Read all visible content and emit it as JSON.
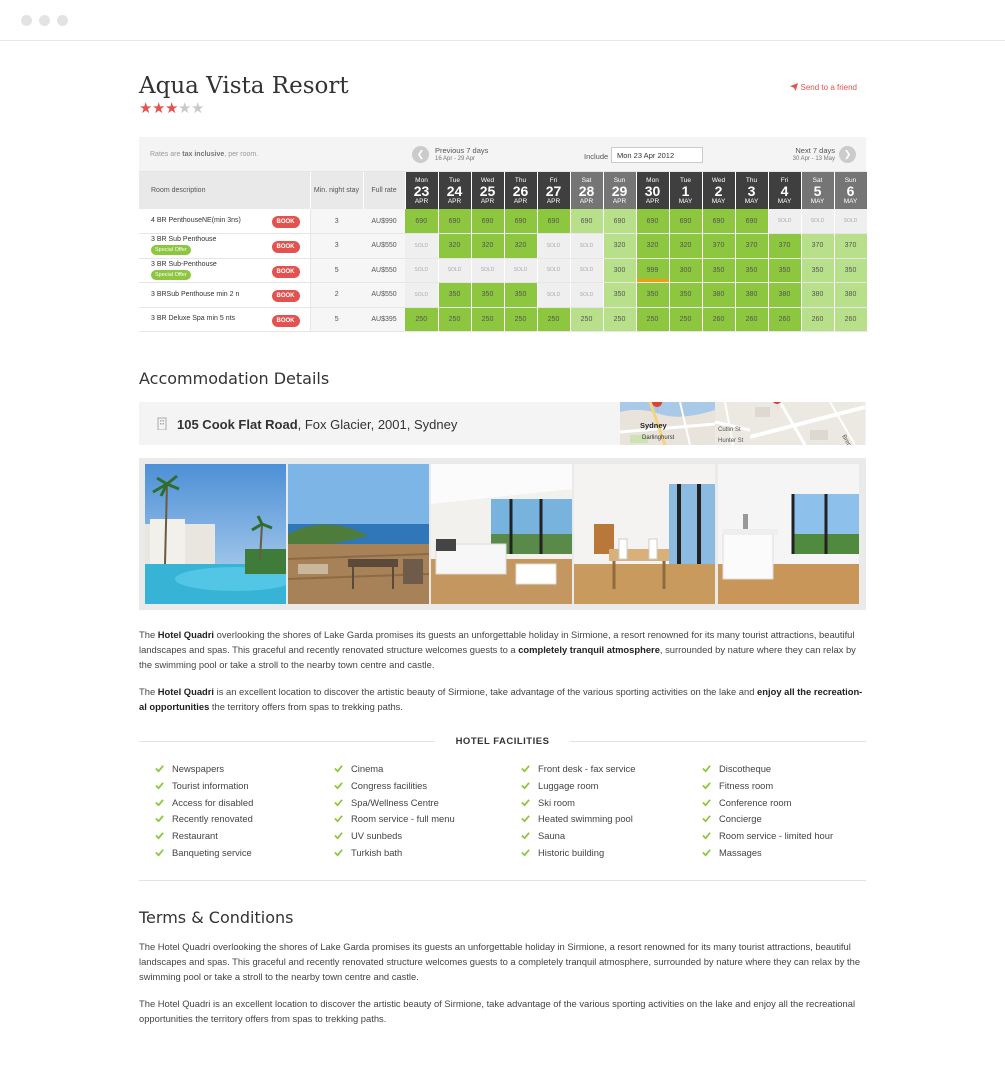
{
  "hotel": {
    "name": "Aqua Vista Resort",
    "rating": 3,
    "max_rating": 5,
    "send_to_friend": "Send to a friend"
  },
  "rates": {
    "note_prefix": "Rates are ",
    "note_bold": "tax inclusive",
    "note_suffix": ", per room.",
    "prev_label": "Previous 7 days",
    "prev_range": "16 Apr - 29 Apr",
    "next_label": "Next 7 days",
    "next_range": "30 Apr - 13 May",
    "include_label": "Include",
    "include_value": "Mon 23 Apr 2012",
    "headers": {
      "desc": "Room description",
      "min": "Min. night stay",
      "full": "Full rate"
    },
    "days": [
      {
        "dow": "Mon",
        "num": "23",
        "mon": "APR",
        "style": "wk"
      },
      {
        "dow": "Tue",
        "num": "24",
        "mon": "APR",
        "style": "wk"
      },
      {
        "dow": "Wed",
        "num": "25",
        "mon": "APR",
        "style": "wk"
      },
      {
        "dow": "Thu",
        "num": "26",
        "mon": "APR",
        "style": "wk"
      },
      {
        "dow": "Fri",
        "num": "27",
        "mon": "APR",
        "style": "wk"
      },
      {
        "dow": "Sat",
        "num": "28",
        "mon": "APR",
        "style": "we"
      },
      {
        "dow": "Sun",
        "num": "29",
        "mon": "APR",
        "style": "we"
      },
      {
        "dow": "Mon",
        "num": "30",
        "mon": "APR",
        "style": "wk"
      },
      {
        "dow": "Tue",
        "num": "1",
        "mon": "MAY",
        "style": "wk"
      },
      {
        "dow": "Wed",
        "num": "2",
        "mon": "MAY",
        "style": "wk"
      },
      {
        "dow": "Thu",
        "num": "3",
        "mon": "MAY",
        "style": "wk"
      },
      {
        "dow": "Fri",
        "num": "4",
        "mon": "MAY",
        "style": "wk"
      },
      {
        "dow": "Sat",
        "num": "5",
        "mon": "MAY",
        "style": "we"
      },
      {
        "dow": "Sun",
        "num": "6",
        "mon": "MAY",
        "style": "we"
      }
    ],
    "book_label": "BOOK",
    "offer_label": "Special Offer",
    "rooms": [
      {
        "name": "4 BR PenthouseNE(min 3ns)",
        "offer": false,
        "min": "3",
        "full": "AU$990",
        "cells": [
          [
            "690",
            "dk"
          ],
          [
            "690",
            "dk"
          ],
          [
            "690",
            "dk"
          ],
          [
            "690",
            "dk"
          ],
          [
            "690",
            "dk"
          ],
          [
            "690",
            "lt"
          ],
          [
            "690",
            "lt"
          ],
          [
            "690",
            "dk"
          ],
          [
            "690",
            "dk"
          ],
          [
            "690",
            "dk"
          ],
          [
            "690",
            "dk"
          ],
          [
            "SOLD",
            "sold"
          ],
          [
            "SOLD",
            "sold"
          ],
          [
            "SOLD",
            "sold"
          ]
        ]
      },
      {
        "name": "3 BR Sub Penthouse",
        "offer": true,
        "min": "3",
        "full": "AU$550",
        "cells": [
          [
            "SOLD",
            "sold"
          ],
          [
            "320",
            "dk"
          ],
          [
            "320",
            "dk"
          ],
          [
            "320",
            "dk"
          ],
          [
            "SOLD",
            "sold"
          ],
          [
            "SOLD",
            "sold"
          ],
          [
            "320",
            "lt"
          ],
          [
            "320",
            "dk"
          ],
          [
            "320",
            "dk"
          ],
          [
            "370",
            "dk"
          ],
          [
            "370",
            "dk"
          ],
          [
            "370",
            "dk"
          ],
          [
            "370",
            "lt"
          ],
          [
            "370",
            "lt"
          ]
        ]
      },
      {
        "name": "3 BR Sub-Penthouse",
        "offer": true,
        "min": "5",
        "full": "AU$550",
        "cells": [
          [
            "SOLD",
            "sold"
          ],
          [
            "SOLD",
            "sold"
          ],
          [
            "SOLD",
            "sold"
          ],
          [
            "SOLD",
            "sold"
          ],
          [
            "SOLD",
            "sold"
          ],
          [
            "SOLD",
            "sold"
          ],
          [
            "300",
            "lt"
          ],
          [
            "999",
            "hl"
          ],
          [
            "300",
            "dk"
          ],
          [
            "350",
            "dk"
          ],
          [
            "350",
            "dk"
          ],
          [
            "350",
            "dk"
          ],
          [
            "350",
            "lt"
          ],
          [
            "350",
            "lt"
          ]
        ]
      },
      {
        "name": "3 BRSub Penthouse min 2 n",
        "offer": false,
        "min": "2",
        "full": "AU$550",
        "cells": [
          [
            "SOLD",
            "sold"
          ],
          [
            "350",
            "dk"
          ],
          [
            "350",
            "dk"
          ],
          [
            "350",
            "dk"
          ],
          [
            "SOLD",
            "sold"
          ],
          [
            "SOLD",
            "sold"
          ],
          [
            "350",
            "lt"
          ],
          [
            "350",
            "dk"
          ],
          [
            "350",
            "dk"
          ],
          [
            "380",
            "dk"
          ],
          [
            "380",
            "dk"
          ],
          [
            "380",
            "dk"
          ],
          [
            "380",
            "lt"
          ],
          [
            "380",
            "lt"
          ]
        ]
      },
      {
        "name": "3 BR Deluxe Spa min 5 nts",
        "offer": false,
        "min": "5",
        "full": "AU$395",
        "cells": [
          [
            "250",
            "dk"
          ],
          [
            "250",
            "dk"
          ],
          [
            "250",
            "dk"
          ],
          [
            "250",
            "dk"
          ],
          [
            "250",
            "dk"
          ],
          [
            "250",
            "lt"
          ],
          [
            "250",
            "lt"
          ],
          [
            "250",
            "dk"
          ],
          [
            "250",
            "dk"
          ],
          [
            "260",
            "dk"
          ],
          [
            "260",
            "dk"
          ],
          [
            "260",
            "dk"
          ],
          [
            "260",
            "lt"
          ],
          [
            "260",
            "lt"
          ]
        ]
      }
    ]
  },
  "accommodation": {
    "heading": "Accommodation Details",
    "address_bold": "105 Cook Flat Road",
    "address_rest": ", Fox Glacier, 2001, Sydney",
    "map_labels": [
      "Sydney",
      "Darlinghurst",
      "Cutlin St",
      "Hunter St",
      "Brent St"
    ]
  },
  "description": {
    "p1": [
      {
        "t": "The ",
        "b": false
      },
      {
        "t": "Hotel Quadri",
        "b": true
      },
      {
        "t": " overlooking the shores of Lake Garda promises its guests an unforgettable holiday in Sirmione, a resort renowned for its many tourist attractions, beautiful landscapes and spas. This graceful and recently renovated structure welcomes guests to a ",
        "b": false
      },
      {
        "t": "completely tranquil atmosphere",
        "b": true
      },
      {
        "t": ", surrounded by nature where they can relax by the swimming pool or take a stroll to the nearby town centre and castle.",
        "b": false
      }
    ],
    "p2": [
      {
        "t": "The ",
        "b": false
      },
      {
        "t": "Hotel Quadri",
        "b": true
      },
      {
        "t": " is an excellent location to discover the artistic beauty of Sirmione, take advantage of the various sporting activities on the lake and ",
        "b": false
      },
      {
        "t": "enjoy all the recreation-al opportunities",
        "b": true
      },
      {
        "t": " the territory offers from spas to trekking paths.",
        "b": false
      }
    ]
  },
  "facilities": {
    "heading": "HOTEL FACILITIES",
    "columns": [
      [
        "Newspapers",
        "Tourist information",
        "Access for disabled",
        "Recently renovated",
        "Restaurant",
        "Banqueting service"
      ],
      [
        "Cinema",
        "Congress facilities",
        "Spa/Wellness Centre",
        "Room service - full menu",
        "UV sunbeds",
        "Turkish bath"
      ],
      [
        "Front desk - fax service",
        "Luggage room",
        "Ski room",
        "Heated swimming pool",
        "Sauna",
        "Historic building"
      ],
      [
        "Discotheque",
        "Fitness room",
        "Conference room",
        "Concierge",
        "Room service - limited hour",
        "Massages"
      ]
    ]
  },
  "terms": {
    "heading": "Terms & Conditions",
    "p1": "The Hotel Quadri overlooking the shores of Lake Garda promises its guests an unforgettable holiday in Sirmione, a resort renowned for its many tourist attractions, beautiful landscapes and spas. This graceful and recently renovated structure welcomes guests to a completely tranquil atmosphere, surrounded by nature where they can relax by the swimming pool or take a stroll to the nearby town centre and castle.",
    "p2": "The Hotel Quadri is an excellent location to discover the artistic beauty of Sirmione, take advantage of the various sporting activities on the lake and enjoy all the recreational opportunities the territory offers from spas to trekking paths."
  },
  "colors": {
    "accent": "#e4524f",
    "available_dark": "#8dc63f",
    "available_light": "#b8e08b",
    "sold": "#efefef"
  }
}
